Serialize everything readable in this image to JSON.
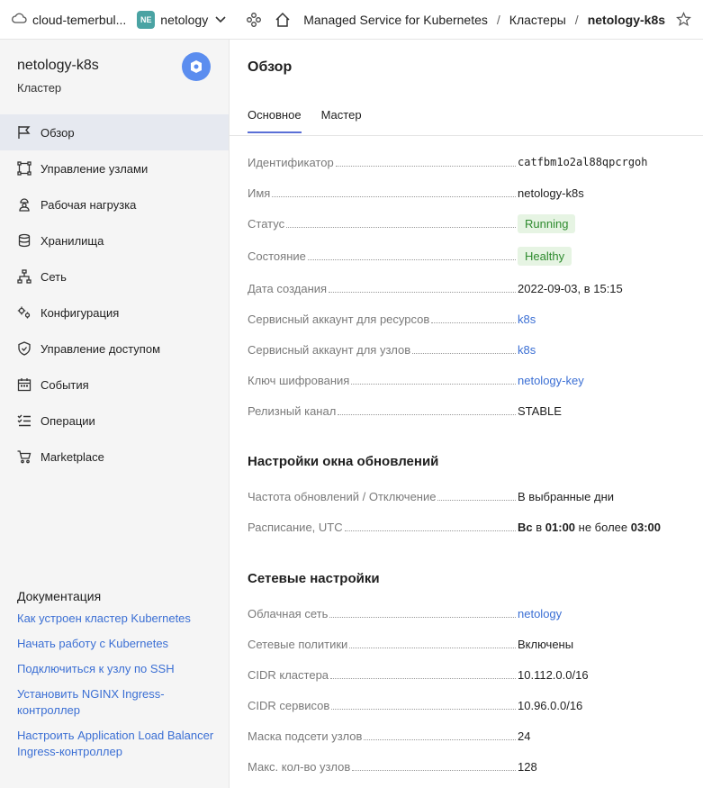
{
  "topbar": {
    "cloud_label": "cloud-temerbul...",
    "folder_badge": "NE",
    "folder_label": "netology",
    "breadcrumbs": [
      "Managed Service for Kubernetes",
      "Кластеры",
      "netology-k8s"
    ],
    "separator": "/"
  },
  "sidebar": {
    "cluster_name": "netology-k8s",
    "cluster_type": "Кластер",
    "nav": [
      {
        "label": "Обзор",
        "icon": "flag-icon"
      },
      {
        "label": "Управление узлами",
        "icon": "nodes-icon"
      },
      {
        "label": "Рабочая нагрузка",
        "icon": "worker-icon"
      },
      {
        "label": "Хранилища",
        "icon": "database-icon"
      },
      {
        "label": "Сеть",
        "icon": "network-icon"
      },
      {
        "label": "Конфигурация",
        "icon": "gears-icon"
      },
      {
        "label": "Управление доступом",
        "icon": "shield-icon"
      },
      {
        "label": "События",
        "icon": "calendar-icon"
      },
      {
        "label": "Операции",
        "icon": "list-icon"
      },
      {
        "label": "Marketplace",
        "icon": "cart-icon"
      }
    ],
    "docs_title": "Документация",
    "docs": [
      "Как устроен кластер Kubernetes",
      "Начать работу с Kubernetes",
      "Подключиться к узлу по SSH",
      "Установить NGINX Ingress-контроллер",
      "Настроить Application Load Balancer Ingress-контроллер"
    ]
  },
  "main": {
    "title": "Обзор",
    "tabs": [
      "Основное",
      "Мастер"
    ],
    "general": [
      {
        "key": "Идентификатор",
        "value": "catfbm1o2al88qpcrgoh"
      },
      {
        "key": "Имя",
        "value": "netology-k8s"
      },
      {
        "key": "Статус",
        "value": "Running"
      },
      {
        "key": "Состояние",
        "value": "Healthy"
      },
      {
        "key": "Дата создания",
        "value": "2022-09-03, в 15:15"
      },
      {
        "key": "Сервисный аккаунт для ресурсов",
        "value": "k8s"
      },
      {
        "key": "Сервисный аккаунт для узлов",
        "value": "k8s"
      },
      {
        "key": "Ключ шифрования",
        "value": "netology-key"
      },
      {
        "key": "Релизный канал",
        "value": "STABLE"
      }
    ],
    "updates_title": "Настройки окна обновлений",
    "updates": {
      "freq_key": "Частота обновлений / Отключение",
      "freq_value": "В выбранные дни",
      "schedule_key": "Расписание, UTC",
      "schedule_day": "Вс",
      "schedule_in": "в",
      "schedule_time": "01:00",
      "schedule_limit": "не более",
      "schedule_duration": "03:00"
    },
    "network_title": "Сетевые настройки",
    "network": [
      {
        "key": "Облачная сеть",
        "value": "netology"
      },
      {
        "key": "Сетевые политики",
        "value": "Включены"
      },
      {
        "key": "CIDR кластера",
        "value": "10.112.0.0/16"
      },
      {
        "key": "CIDR сервисов",
        "value": "10.96.0.0/16"
      },
      {
        "key": "Маска подсети узлов",
        "value": "24"
      },
      {
        "key": "Макс. кол-во узлов",
        "value": "128"
      }
    ]
  },
  "colors": {
    "accent": "#5b8def",
    "link": "#3b6fd4",
    "success_bg": "#e6f4e3",
    "success_text": "#2e8b2e"
  }
}
